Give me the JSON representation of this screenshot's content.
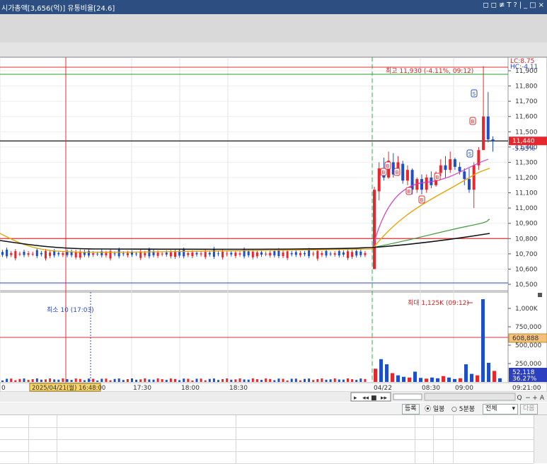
{
  "title": "시가총액[3,656(억)]  유통비율[24.6]",
  "title_controls": [
    "◻",
    "◻",
    "≢",
    "T",
    "?",
    "|",
    "_",
    "□",
    "×"
  ],
  "price_axis": {
    "top_labels": {
      "lc": "LC:8.75",
      "hc": "HC:-4.11"
    },
    "ticks": [
      "11,900",
      "11,800",
      "11,700",
      "11,600",
      "11,500",
      "11,400",
      "11,300",
      "11,200",
      "11,100",
      "11,000",
      "10,900",
      "10,800",
      "10,700",
      "10,600",
      "10,500"
    ],
    "current_price": "11,440",
    "current_change": "-5.93%"
  },
  "price_annotation": "최고 11,930 (-4.11%, 09:12)",
  "volume_axis": {
    "ticks": [
      "1,000K",
      "750,000",
      "500,000",
      "250,000"
    ],
    "avg_marker": "608,888",
    "current_vol": "52,118",
    "current_pct": "36.27%"
  },
  "volume_annotation_max": "최대 1,125K (09:12)",
  "volume_annotation_min": "최소 10 (17:03)",
  "time_axis": {
    "ticks": [
      "0",
      "17:30",
      "18:00",
      "18:30",
      "04/22",
      "08:30",
      "09:00"
    ],
    "cursor_label": "2025/04/21(월) 16:48:00",
    "end_label": "09:21:00"
  },
  "signals": [
    "S",
    "S",
    "B",
    "B",
    "B",
    "B",
    "B",
    "B",
    "B"
  ],
  "nav_controls": [
    "▸",
    "◂◂",
    "■",
    "▸▸",
    "Q",
    "−",
    "+",
    "A"
  ],
  "bottom_bar": {
    "register": "등록",
    "daily": "일봉",
    "five_min": "5분봉",
    "select": "전체",
    "next": "다음"
  },
  "chart_data": {
    "type": "candlestick",
    "colors": {
      "up": "#e8262d",
      "down": "#1f4fc8",
      "ma_fast": "#d43ac8",
      "ma_mid": "#e4a300",
      "ma_slow": "#3a9a3a",
      "ma_long": "#111111",
      "bg": "#ffffff"
    },
    "price_range": [
      10480,
      11980
    ],
    "reference_lines": {
      "high_red": 11930,
      "green": 11890,
      "black": 11440,
      "red_low": 10800,
      "blue_low": 10510
    },
    "session1_close_level": 10700,
    "session2": [
      {
        "o": 10600,
        "c": 11120,
        "h": 11140,
        "l": 10600
      },
      {
        "o": 11110,
        "c": 11260,
        "h": 11300,
        "l": 11050
      },
      {
        "o": 11250,
        "c": 11200,
        "h": 11330,
        "l": 11180
      },
      {
        "o": 11200,
        "c": 11310,
        "h": 11370,
        "l": 11190
      },
      {
        "o": 11300,
        "c": 11220,
        "h": 11360,
        "l": 11200
      },
      {
        "o": 11230,
        "c": 11300,
        "h": 11340,
        "l": 11210
      },
      {
        "o": 11290,
        "c": 11180,
        "h": 11310,
        "l": 11160
      },
      {
        "o": 11180,
        "c": 11250,
        "h": 11280,
        "l": 11150
      },
      {
        "o": 11250,
        "c": 11120,
        "h": 11260,
        "l": 11090
      },
      {
        "o": 11120,
        "c": 11190,
        "h": 11200,
        "l": 11100
      },
      {
        "o": 11190,
        "c": 11120,
        "h": 11220,
        "l": 11090
      },
      {
        "o": 11120,
        "c": 11200,
        "h": 11220,
        "l": 11100
      },
      {
        "o": 11200,
        "c": 11150,
        "h": 11240,
        "l": 11130
      },
      {
        "o": 11150,
        "c": 11230,
        "h": 11240,
        "l": 11140
      },
      {
        "o": 11230,
        "c": 11280,
        "h": 11320,
        "l": 11210
      },
      {
        "o": 11280,
        "c": 11250,
        "h": 11340,
        "l": 11200
      },
      {
        "o": 11250,
        "c": 11320,
        "h": 11370,
        "l": 11230
      },
      {
        "o": 11320,
        "c": 11270,
        "h": 11330,
        "l": 11250
      },
      {
        "o": 11270,
        "c": 11240,
        "h": 11300,
        "l": 11220
      },
      {
        "o": 11240,
        "c": 11190,
        "h": 11260,
        "l": 11150
      },
      {
        "o": 11190,
        "c": 11120,
        "h": 11260,
        "l": 11100
      },
      {
        "o": 11120,
        "c": 11280,
        "h": 11300,
        "l": 11000
      },
      {
        "o": 11280,
        "c": 11380,
        "h": 11400,
        "l": 11250
      },
      {
        "o": 11380,
        "c": 11600,
        "h": 11930,
        "l": 11380
      },
      {
        "o": 11600,
        "c": 11450,
        "h": 11760,
        "l": 11430
      },
      {
        "o": 11450,
        "c": 11440,
        "h": 11470,
        "l": 11370
      }
    ],
    "volumes_session2": [
      180,
      310,
      240,
      120,
      90,
      70,
      60,
      140,
      55,
      45,
      60,
      50,
      80,
      60,
      40,
      50,
      240,
      110,
      90,
      1125,
      260,
      150,
      50
    ]
  }
}
